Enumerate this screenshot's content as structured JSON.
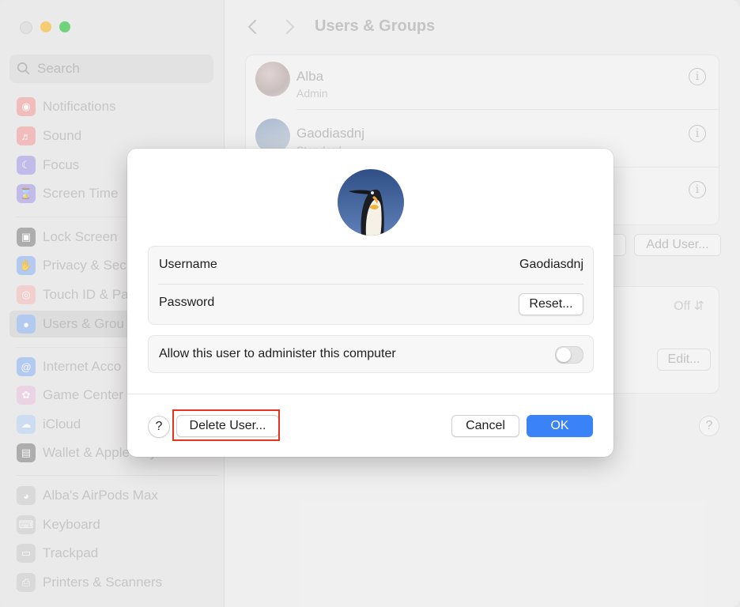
{
  "window": {
    "controls": [
      "close",
      "minimize",
      "zoom"
    ]
  },
  "sidebar": {
    "search_placeholder": "Search",
    "items": [
      {
        "label": "Notifications",
        "icon": "bell-icon",
        "color": "#f25b5b"
      },
      {
        "label": "Sound",
        "icon": "speaker-icon",
        "color": "#f25b5b"
      },
      {
        "label": "Focus",
        "icon": "moon-icon",
        "color": "#6b5bd6"
      },
      {
        "label": "Screen Time",
        "icon": "hourglass-icon",
        "color": "#6b5bd6"
      },
      {
        "label": "Lock Screen",
        "icon": "lock-icon",
        "color": "#2f2f2f"
      },
      {
        "label": "Privacy & Sec",
        "icon": "hand-icon",
        "color": "#3f7ff0"
      },
      {
        "label": "Touch ID & Pa",
        "icon": "fingerprint-icon",
        "color": "#f07a7a"
      },
      {
        "label": "Users & Grou",
        "icon": "users-icon",
        "color": "#3f7ff0",
        "selected": true
      },
      {
        "label": "Internet Acco",
        "icon": "at-icon",
        "color": "#3f7ff0"
      },
      {
        "label": "Game Center",
        "icon": "game-center-icon",
        "color": "#e0a0d0"
      },
      {
        "label": "iCloud",
        "icon": "cloud-icon",
        "color": "#7fb2f0"
      },
      {
        "label": "Wallet & Apple Pay",
        "icon": "wallet-icon",
        "color": "#2f2f2f"
      },
      {
        "label": "Alba's AirPods Max",
        "icon": "headphones-icon",
        "color": "#a9a9a9"
      },
      {
        "label": "Keyboard",
        "icon": "keyboard-icon",
        "color": "#a9a9a9"
      },
      {
        "label": "Trackpad",
        "icon": "trackpad-icon",
        "color": "#a9a9a9"
      },
      {
        "label": "Printers & Scanners",
        "icon": "printer-icon",
        "color": "#a9a9a9"
      }
    ]
  },
  "main": {
    "title": "Users & Groups",
    "users": [
      {
        "name": "Alba",
        "role": "Admin"
      },
      {
        "name": "Gaodiasdnj",
        "role": "Standard"
      },
      {
        "name": "",
        "role": ""
      }
    ],
    "add_user_label": "Add User...",
    "off_value": "Off",
    "edit_label": "Edit..."
  },
  "dialog": {
    "username_label": "Username",
    "username_value": "Gaodiasdnj",
    "password_label": "Password",
    "reset_label": "Reset...",
    "admin_label": "Allow this user to administer this computer",
    "admin_enabled": false,
    "help_label": "?",
    "delete_label": "Delete User...",
    "cancel_label": "Cancel",
    "ok_label": "OK",
    "highlight_color": "#e5331f",
    "accent_color": "#3a82f7"
  }
}
